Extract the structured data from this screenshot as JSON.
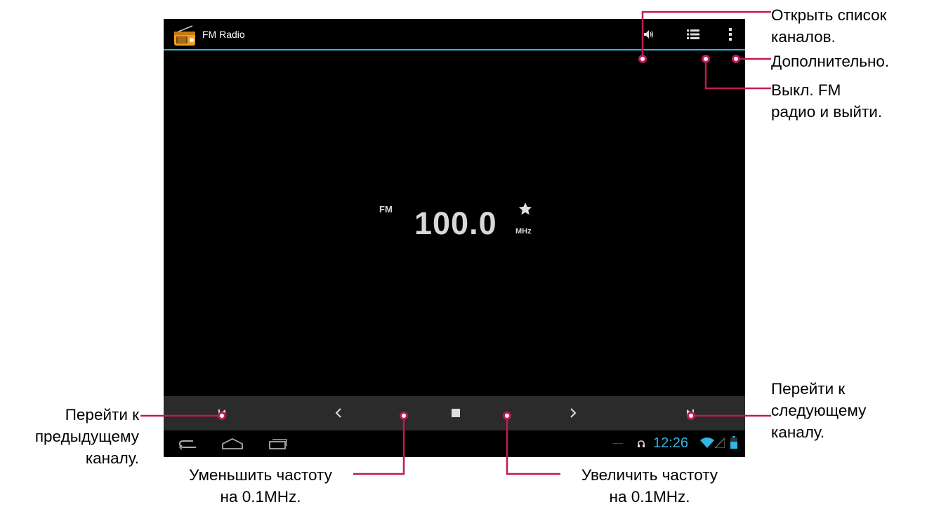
{
  "app": {
    "title": "FM Radio",
    "icon": "radio-icon"
  },
  "actionbar": {
    "speaker_icon": "speaker-icon",
    "channel_list_icon": "channel-list-icon",
    "overflow_icon": "overflow-menu-icon",
    "accent_color": "#33b5e5"
  },
  "tuner": {
    "band": "FM",
    "frequency": "100.0",
    "unit": "MHz",
    "favorite_icon": "star-icon"
  },
  "controls": [
    "prev-station-icon",
    "tune-down-icon",
    "stop-icon",
    "tune-up-icon",
    "next-station-icon"
  ],
  "navbar": {
    "buttons": [
      "back-icon",
      "home-icon",
      "recent-apps-icon"
    ],
    "time": "12:26",
    "status_icons": [
      "headset-icon",
      "wifi-icon",
      "signal-icon",
      "battery-icon"
    ]
  },
  "annotations": {
    "channel_list": [
      "Открыть список",
      "каналов."
    ],
    "more": [
      "Дополнительно."
    ],
    "exit": [
      "Выкл. FM",
      "радио и выйти."
    ],
    "prev_channel": [
      "Перейти к",
      "предыдущему",
      "каналу."
    ],
    "next_channel": [
      "Перейти к",
      "следующему",
      "каналу."
    ],
    "decrease": [
      "Уменьшить частоту",
      "на 0.1MHz."
    ],
    "increase": [
      "Увеличить частоту",
      "на 0.1MHz."
    ],
    "line_color": "#c2185b"
  }
}
